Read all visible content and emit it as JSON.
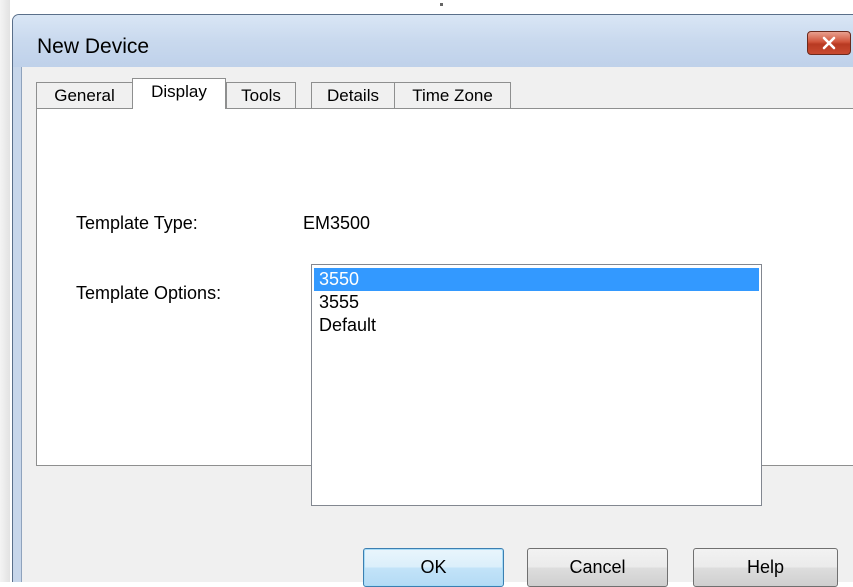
{
  "window": {
    "title": "New Device",
    "close_icon": "close-x-icon"
  },
  "tabs": [
    {
      "label": "General",
      "active": false
    },
    {
      "label": "Display",
      "active": true
    },
    {
      "label": "Tools",
      "active": false
    },
    {
      "label": "Details",
      "active": false
    },
    {
      "label": "Time Zone",
      "active": false
    }
  ],
  "display": {
    "template_type_label": "Template Type:",
    "template_type_value": "EM3500",
    "template_options_label": "Template Options:",
    "template_options": [
      "3550",
      "3555",
      "Default"
    ],
    "selected_option": "3550"
  },
  "buttons": {
    "ok": "OK",
    "cancel": "Cancel",
    "help": "Help"
  },
  "colors": {
    "selection": "#3399ff",
    "close_button": "#c84a30",
    "title_bar": "#c9d9ee"
  }
}
